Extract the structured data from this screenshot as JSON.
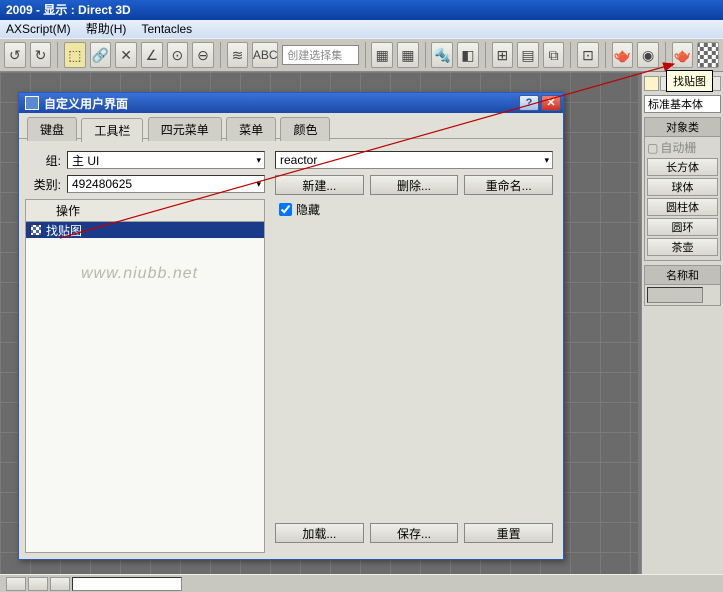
{
  "titlebar": "2009    - 显示 : Direct 3D",
  "menubar": {
    "a": "AXScript(M)",
    "b": "帮助(H)",
    "c": "Tentacles"
  },
  "toolbar": {
    "combo": "创建选择集"
  },
  "tooltip": "找贴图",
  "cmdpanel": {
    "dropdown": "标准基本体",
    "roll1": "对象类",
    "auto": "自动栅",
    "btns": [
      "长方体",
      "球体",
      "圆柱体",
      "圆环",
      "茶壶"
    ],
    "roll2": "名称和"
  },
  "dialog": {
    "title": "自定义用户界面",
    "tabs": [
      "键盘",
      "工具栏",
      "四元菜单",
      "菜单",
      "颜色"
    ],
    "group_lbl": "组:",
    "group_val": "主 UI",
    "cat_lbl": "类别:",
    "cat_val": "492480625",
    "list_hdr": "操作",
    "list_item": "找贴图",
    "right_combo": "reactor",
    "btn_new": "新建...",
    "btn_del": "删除...",
    "btn_ren": "重命名...",
    "chk_hide": "隐藏",
    "btn_load": "加载...",
    "btn_save": "保存...",
    "btn_reset": "重置"
  },
  "watermark": "www.niubb.net"
}
